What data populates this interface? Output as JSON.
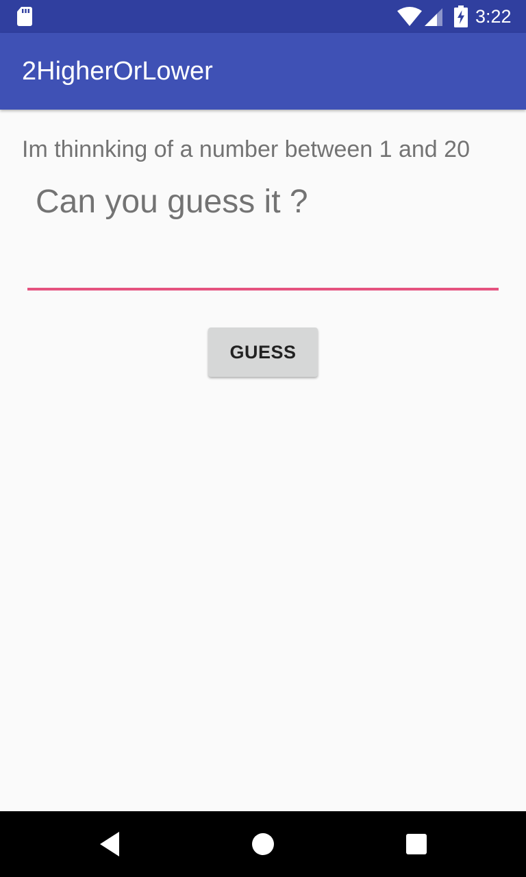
{
  "status_bar": {
    "time": "3:22",
    "icons": [
      "sd-card-icon",
      "wifi-icon",
      "cell-signal-icon",
      "battery-charging-icon"
    ],
    "color": "#303f9f"
  },
  "app_bar": {
    "title": "2HigherOrLower",
    "color": "#3f51b5"
  },
  "main": {
    "prompt": "Im thinnking of a number between 1 and 20",
    "question": "Can you guess it ?",
    "guess_input": {
      "value": "",
      "placeholder": "",
      "underline_color": "#e5527f"
    },
    "guess_button_label": "GUESS"
  },
  "nav_bar": {
    "icons": [
      "back-icon",
      "home-icon",
      "recents-icon"
    ]
  }
}
